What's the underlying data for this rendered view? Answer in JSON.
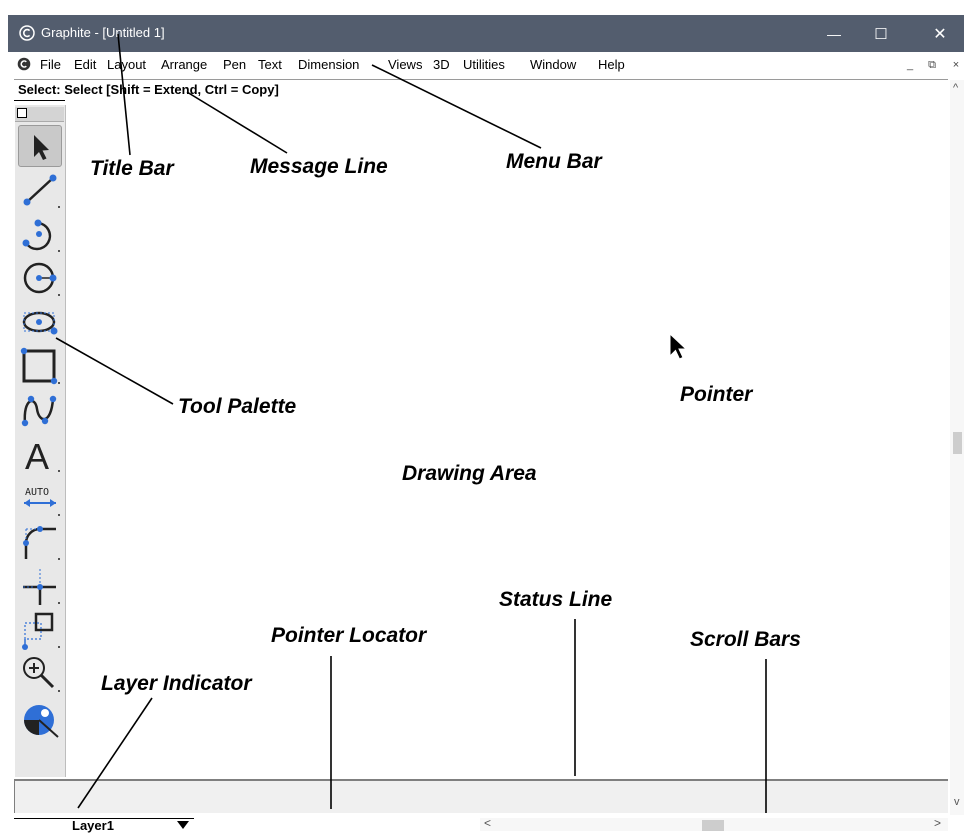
{
  "window": {
    "title": "Graphite - [Untitled 1]",
    "controls": {
      "minimize": "—",
      "maximize": "☐",
      "close": "✕"
    }
  },
  "menubar": {
    "items": [
      "File",
      "Edit",
      "Layout",
      "Arrange",
      "Pen",
      "Text",
      "Dimension",
      "Views",
      "3D",
      "Utilities",
      "Window",
      "Help"
    ],
    "mdi_controls": [
      "_",
      "⧉",
      "×"
    ]
  },
  "message_line": {
    "text": "Select: Select  [Shift = Extend, Ctrl = Copy]"
  },
  "tool_palette": {
    "tools": [
      "pointer-tool",
      "line-tool",
      "arc-tool",
      "circle-tool",
      "ellipse-tool",
      "rectangle-tool",
      "spline-tool",
      "text-tool",
      "auto-dimension-tool",
      "fillet-tool",
      "perpendicular-tool",
      "align-tool",
      "zoom-tool",
      "view-tool"
    ],
    "auto_label": "AUTO",
    "text_tool_glyph": "A"
  },
  "layer_indicator": {
    "value": "Layer1"
  },
  "scrollbars": {
    "left_arrow": "<",
    "right_arrow": ">",
    "up_arrow": "^",
    "down_arrow": "v"
  },
  "annotations": {
    "title_bar": "Title Bar",
    "message_line": "Message Line",
    "menu_bar": "Menu Bar",
    "pointer": "Pointer",
    "tool_palette": "Tool Palette",
    "drawing_area": "Drawing Area",
    "status_line": "Status Line",
    "pointer_locator": "Pointer Locator",
    "scroll_bars": "Scroll Bars",
    "layer_indicator": "Layer Indicator"
  },
  "colors": {
    "titlebar": "#535d6e",
    "tool_accent": "#2f6fd6",
    "palette_bg": "#e8e8e8"
  }
}
